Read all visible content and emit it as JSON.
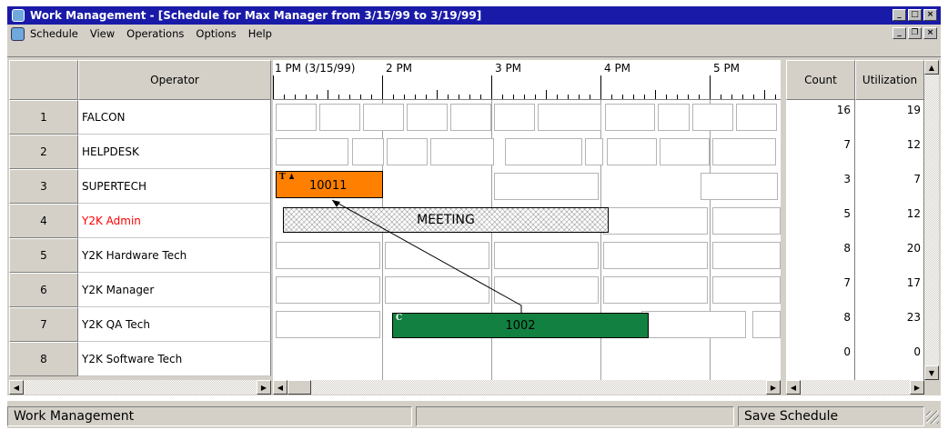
{
  "window": {
    "title": "Work Management - [Schedule for Max Manager from 3/15/99 to 3/19/99]"
  },
  "menu": [
    "Schedule",
    "View",
    "Operations",
    "Options",
    "Help"
  ],
  "grid": {
    "operator_header": "Operator",
    "rows": [
      {
        "num": "1",
        "name": "FALCON",
        "color": "#000000"
      },
      {
        "num": "2",
        "name": "HELPDESK",
        "color": "#000000"
      },
      {
        "num": "3",
        "name": "SUPERTECH",
        "color": "#000000"
      },
      {
        "num": "4",
        "name": "Y2K Admin",
        "color": "#ff0000"
      },
      {
        "num": "5",
        "name": "Y2K Hardware Tech",
        "color": "#000000"
      },
      {
        "num": "6",
        "name": "Y2K Manager",
        "color": "#000000"
      },
      {
        "num": "7",
        "name": "Y2K QA Tech",
        "color": "#000000"
      },
      {
        "num": "8",
        "name": "Y2K Software Tech",
        "color": "#000000"
      }
    ]
  },
  "timeline": {
    "labels": [
      "1 PM (3/15/99)",
      "2 PM",
      "3 PM",
      "4 PM",
      "5 PM"
    ]
  },
  "tasks": {
    "t10011": {
      "label": "10011",
      "flag": "T",
      "color": "#ff8000"
    },
    "meeting": {
      "label": "MEETING"
    },
    "t1002": {
      "label": "1002",
      "flag": "C",
      "color": "#128040"
    }
  },
  "stats": {
    "headers": {
      "count": "Count",
      "utilization": "Utilization"
    },
    "rows": [
      {
        "count": "16",
        "util": "19"
      },
      {
        "count": "7",
        "util": "12"
      },
      {
        "count": "3",
        "util": "7"
      },
      {
        "count": "5",
        "util": "12"
      },
      {
        "count": "8",
        "util": "20"
      },
      {
        "count": "7",
        "util": "17"
      },
      {
        "count": "8",
        "util": "23"
      },
      {
        "count": "0",
        "util": "0"
      }
    ]
  },
  "statusbar": {
    "left": "Work Management",
    "right": "Save Schedule"
  }
}
